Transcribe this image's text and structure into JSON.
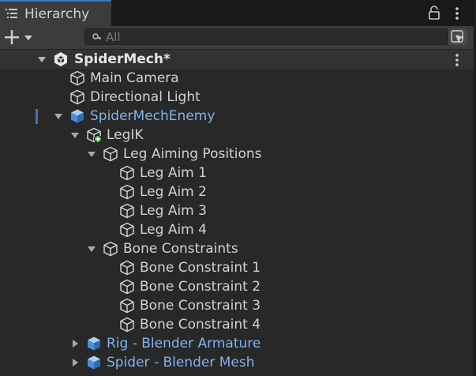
{
  "window": {
    "tab_label": "Hierarchy"
  },
  "toolbar": {
    "search_placeholder": "All"
  },
  "tree": {
    "scene_name": "SpiderMech*",
    "items": [
      {
        "label": "Main Camera",
        "type": "gameobject"
      },
      {
        "label": "Directional Light",
        "type": "gameobject"
      },
      {
        "label": "SpiderMechEnemy",
        "type": "prefab",
        "expanded": true
      },
      {
        "label": "LegIK",
        "type": "gameobject-added",
        "expanded": true
      },
      {
        "label": "Leg Aiming Positions",
        "type": "gameobject",
        "expanded": true
      },
      {
        "label": "Leg Aim 1",
        "type": "gameobject"
      },
      {
        "label": "Leg Aim 2",
        "type": "gameobject"
      },
      {
        "label": "Leg Aim 3",
        "type": "gameobject"
      },
      {
        "label": "Leg Aim 4",
        "type": "gameobject"
      },
      {
        "label": "Bone Constraints",
        "type": "gameobject",
        "expanded": true
      },
      {
        "label": "Bone Constraint 1",
        "type": "gameobject"
      },
      {
        "label": "Bone Constraint 2",
        "type": "gameobject"
      },
      {
        "label": "Bone Constraint 3",
        "type": "gameobject"
      },
      {
        "label": "Bone Constraint 4",
        "type": "gameobject"
      },
      {
        "label": "Rig - Blender Armature",
        "type": "prefab",
        "expanded": false
      },
      {
        "label": "Spider - Blender Mesh",
        "type": "prefab",
        "expanded": false
      }
    ]
  },
  "colors": {
    "accent": "#3a79bb",
    "prefab_text": "#7fb4ee",
    "added_badge": "#2fa84f"
  }
}
